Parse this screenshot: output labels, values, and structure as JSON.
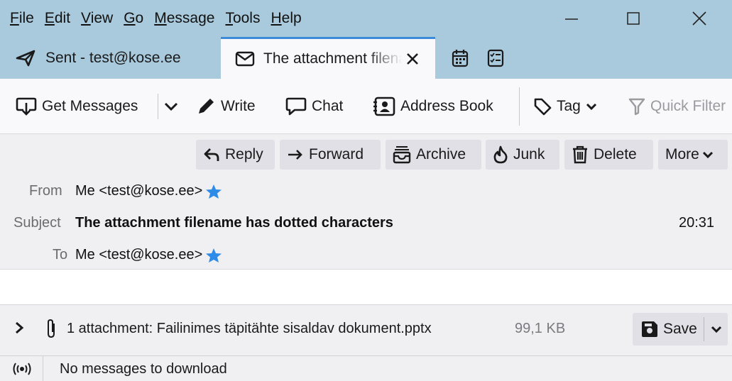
{
  "menu": {
    "file": {
      "ul": "F",
      "rest": "ile"
    },
    "edit": {
      "ul": "E",
      "rest": "dit"
    },
    "view": {
      "ul": "V",
      "rest": "iew"
    },
    "go": {
      "ul": "G",
      "rest": "o"
    },
    "message": {
      "ul": "M",
      "rest": "essage"
    },
    "tools": {
      "ul": "T",
      "rest": "ools"
    },
    "help": {
      "ul": "H",
      "rest": "elp"
    }
  },
  "tabs": {
    "sent": "Sent - test@kose.ee",
    "active": "The attachment filename has dotted characters"
  },
  "toolbar": {
    "get_messages": "Get Messages",
    "write": "Write",
    "chat": "Chat",
    "address_book": "Address Book",
    "tag": "Tag",
    "quick_filter": "Quick Filter"
  },
  "actions": {
    "reply": "Reply",
    "forward": "Forward",
    "archive": "Archive",
    "junk": "Junk",
    "delete": "Delete",
    "more": "More"
  },
  "header": {
    "from_label": "From",
    "from_value": "Me <test@kose.ee>",
    "subject_label": "Subject",
    "subject_value": "The attachment filename has dotted characters",
    "time": "20:31",
    "to_label": "To",
    "to_value": "Me <test@kose.ee>"
  },
  "attachment": {
    "summary": "1 attachment: Failinimes täpitähte sisaldav dokument.pptx",
    "size": "99,1 KB",
    "save": "Save"
  },
  "status": {
    "text": "No messages to download"
  },
  "colors": {
    "titlebar": "#a9c9dc",
    "accent": "#3b8bd9",
    "star": "#2e8ce8"
  }
}
